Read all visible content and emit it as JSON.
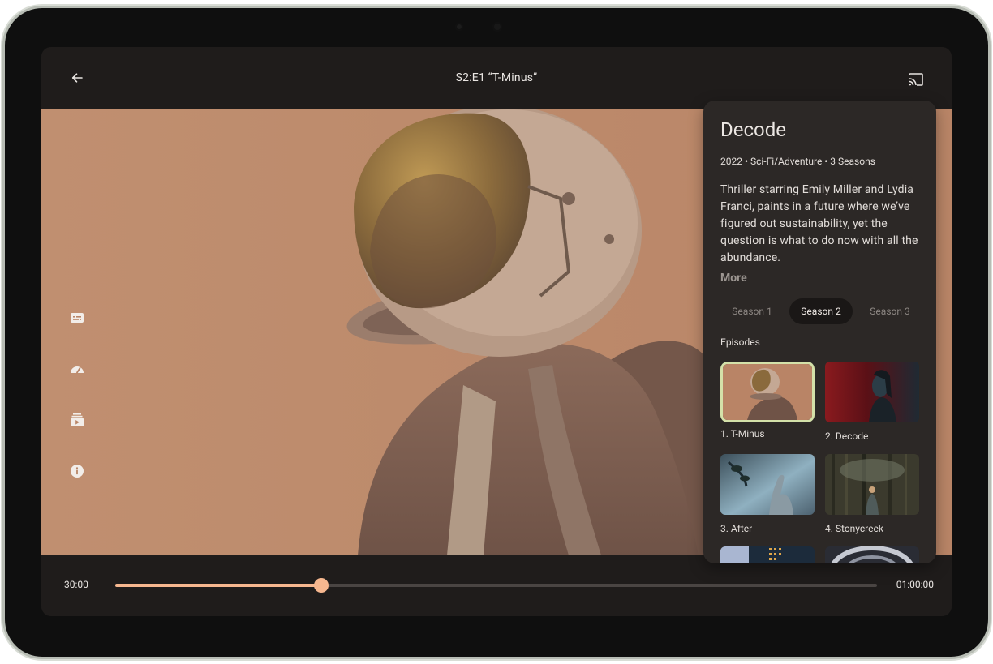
{
  "topbar": {
    "title": "S2:E1 “T-Minus”",
    "back_icon": "arrow-left-icon",
    "cast_icon": "cast-icon"
  },
  "side_controls": [
    {
      "name": "subtitles-button",
      "icon": "subtitles-icon"
    },
    {
      "name": "playback-speed-button",
      "icon": "speed-icon"
    },
    {
      "name": "episodes-button",
      "icon": "playlist-icon"
    },
    {
      "name": "info-button",
      "icon": "info-icon"
    }
  ],
  "player": {
    "current_time": "30:00",
    "total_time": "01:00:00",
    "progress": 0.27
  },
  "details": {
    "title": "Decode",
    "meta": "2022 • Sci-Fi/Adventure • 3 Seasons",
    "description": "Thriller starring Emily Miller and Lydia Franci, paints in a future where we’ve figured out sustainability, yet the question is what to do now with all the abundance.",
    "more_label": "More",
    "seasons": [
      "Season 1",
      "Season 2",
      "Season 3"
    ],
    "selected_season": "Season 2",
    "episodes_heading": "Episodes",
    "episodes": [
      {
        "label": "1. T-Minus"
      },
      {
        "label": "2. Decode"
      },
      {
        "label": "3. After"
      },
      {
        "label": "4. Stonycreek"
      }
    ]
  },
  "colors": {
    "accent": "#f6b78f",
    "selected_outline": "#d4e1a9",
    "panel_bg": "#2c2826",
    "bar_bg": "#1f1c1b"
  }
}
